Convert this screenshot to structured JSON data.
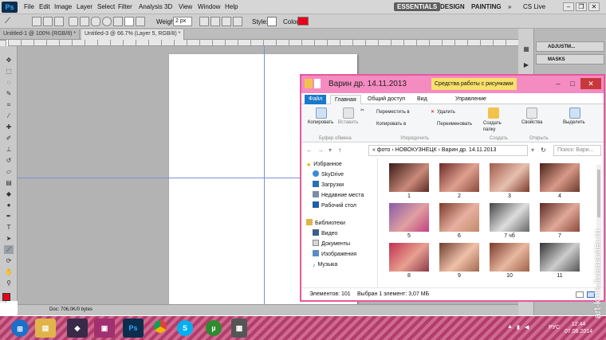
{
  "app": {
    "logo": "Ps",
    "menu": [
      "File",
      "Edit",
      "Image",
      "Layer",
      "Select",
      "Filter",
      "Analysis",
      "3D",
      "View",
      "Window",
      "Help"
    ]
  },
  "workspaces": {
    "active": "ESSENTIALS",
    "others": [
      "DESIGN",
      "PAINTING"
    ],
    "more": "»",
    "cs_live": "CS Live"
  },
  "options": {
    "weight_label": "Weight:",
    "weight_value": "2 px",
    "style_label": "Style:",
    "color_label": "Color:",
    "color": "#e8001a"
  },
  "doc_tabs": [
    "Untitled-1 @ 100% (RGB/8) *",
    "Untitled-3 @ 66.7% (Layer 5, RGB/8) *"
  ],
  "status_doc": "Doc: 706,0K/0 bytes",
  "panels": [
    "ADJUSTM...",
    "MASKS"
  ],
  "explorer": {
    "title": "Варин др. 14.11.2013",
    "context_tab": "Средства работы с рисунками",
    "tabs": [
      "Файл",
      "Главная",
      "Общий доступ",
      "Вид",
      "Управление"
    ],
    "ribbon": {
      "copy": "Копировать",
      "paste": "Вставить",
      "move_to": "Переместить в",
      "copy_to": "Копировать в",
      "delete": "Удалить",
      "rename": "Переименовать",
      "new_folder": "Создать папку",
      "properties": "Свойства",
      "select": "Выделить",
      "groups": [
        "Буфер обмена",
        "Упорядочить",
        "Создать",
        "Открыть"
      ]
    },
    "address": [
      "фото",
      "НОВОКУЗНЕЦК",
      "Варин др. 14.11.2013"
    ],
    "search_placeholder": "Поиск: Вари...",
    "nav": [
      {
        "label": "Избранное",
        "icon": "star-icon"
      },
      {
        "label": "SkyDrive",
        "icon": "cloud-icon"
      },
      {
        "label": "Загрузки",
        "icon": "download-icon"
      },
      {
        "label": "Недавние места",
        "icon": "recent-icon"
      },
      {
        "label": "Рабочий стол",
        "icon": "desktop-icon"
      },
      {
        "label": "Библиотеки",
        "icon": "library-icon"
      },
      {
        "label": "Видео",
        "icon": "video-icon"
      },
      {
        "label": "Документы",
        "icon": "documents-icon"
      },
      {
        "label": "Изображения",
        "icon": "pictures-icon"
      },
      {
        "label": "Музыка",
        "icon": "music-icon"
      }
    ],
    "thumbs": [
      "1",
      "2",
      "3",
      "4",
      "5",
      "6",
      "7 чб",
      "7",
      "8",
      "9",
      "10",
      "11"
    ],
    "status_count": "Элементов: 101",
    "status_selected": "Выбран 1 элемент: 3,07 МБ"
  },
  "taskbar": {
    "clock_time": "12:44",
    "clock_date": "07.06.2014",
    "lang": "РУС"
  },
  "watermark": "art-kote.livemaster.ru"
}
